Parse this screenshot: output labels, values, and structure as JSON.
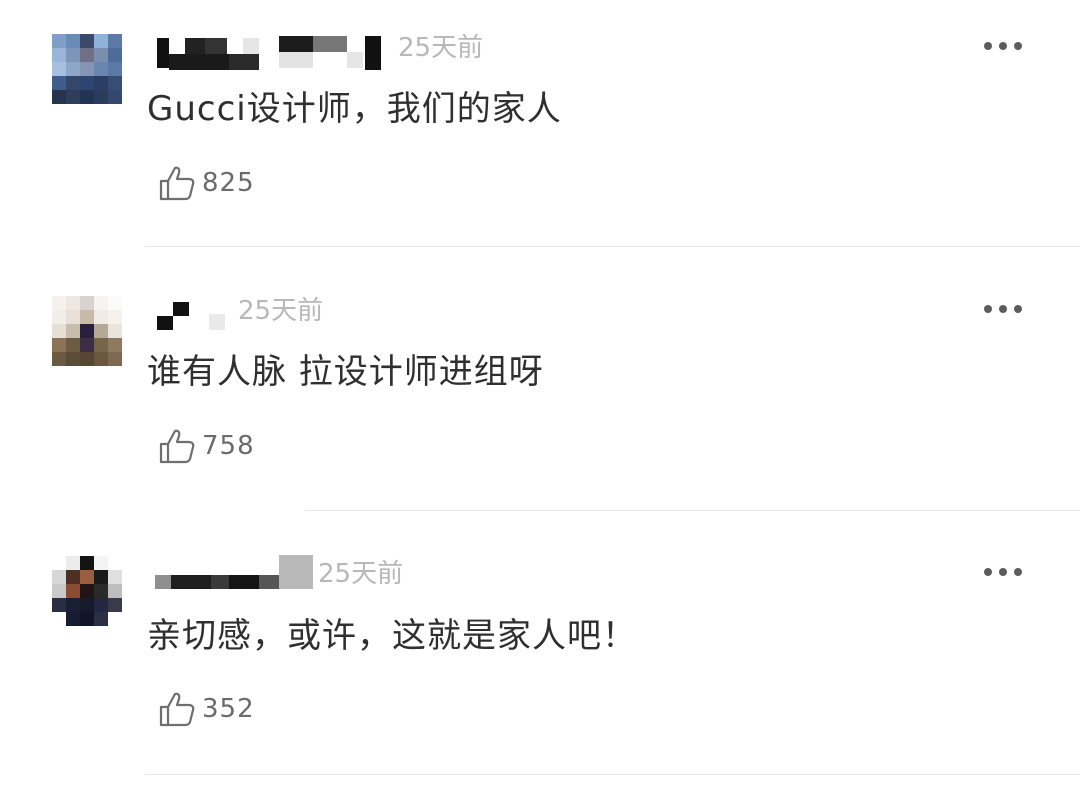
{
  "comments": [
    {
      "time": "25天前",
      "content": "Gucci设计师，我们的家人",
      "likes": "825",
      "avatar_colors": [
        "#7f9fc8",
        "#6a8ab8",
        "#3b4a6a",
        "#8fb1dc",
        "#5c79a8",
        "#9ab5d9",
        "#7d95b9",
        "#6f6f86",
        "#7a8fb0",
        "#4e6c9a",
        "#a7c0e0",
        "#8ea6c8",
        "#8594b4",
        "#6985b0",
        "#5b78a6",
        "#3f5c8c",
        "#34466a",
        "#2f4470",
        "#2b3f66",
        "#394d74",
        "#26344f",
        "#2e3d5c",
        "#233452",
        "#2a3b5c",
        "#34476d"
      ]
    },
    {
      "time": "25天前",
      "content": "谁有人脉 拉设计师进组呀",
      "likes": "758",
      "avatar_colors": [
        "#f4f1ee",
        "#efe7e2",
        "#d9d3cf",
        "#f6f4f2",
        "#fbfbfb",
        "#f1ede8",
        "#e9dfd6",
        "#c9b9a9",
        "#f0ebe6",
        "#f5f2ee",
        "#e6dfd6",
        "#c8bcad",
        "#2a1f3f",
        "#b5a894",
        "#e9e4dd",
        "#8a7356",
        "#6d5b44",
        "#3b2f44",
        "#776449",
        "#8f7a5e",
        "#6c5a40",
        "#5b4c38",
        "#584634",
        "#6a573e",
        "#7d6a50"
      ]
    },
    {
      "time": "25天前",
      "content": "亲切感，或许，这就是家人吧！",
      "likes": "352",
      "avatar_colors": [
        "#ffffff",
        "#ececec",
        "#141414",
        "#f4f4f4",
        "#ffffff",
        "#d7d7d7",
        "#4d3024",
        "#9a5e3e",
        "#1a1a1a",
        "#e0e0e0",
        "#c9c9c9",
        "#8a4c35",
        "#201414",
        "#2a2a2a",
        "#bdbdbd",
        "#2b2d44",
        "#1b1f33",
        "#151a2d",
        "#242741",
        "#3a3a4a",
        "#ffffff",
        "#171c30",
        "#10152a",
        "#2b2e45",
        "#ffffff"
      ]
    }
  ],
  "icons": {
    "more": "more-dots-icon",
    "like": "thumbs-up-icon"
  }
}
